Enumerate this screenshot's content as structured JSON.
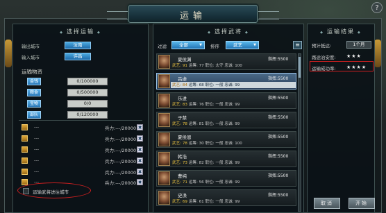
{
  "window": {
    "title": "运输",
    "help_label": "?"
  },
  "left_panel": {
    "title": "选择运输",
    "source_city_label": "输出城市",
    "source_city_value": "汝南",
    "target_city_label": "输入城市",
    "target_city_value": "许昌",
    "resources_heading": "运输物资",
    "resources": [
      {
        "label": "金钱",
        "value": "0/100000"
      },
      {
        "label": "粮食",
        "value": "0/500000"
      },
      {
        "label": "宝物",
        "value": "0/0"
      },
      {
        "label": "部队",
        "value": "0/120000"
      }
    ],
    "slots": [
      {
        "name": "---",
        "troops": "兵力:---/20000",
        "remove": "✖"
      },
      {
        "name": "---",
        "troops": "兵力:---/20000",
        "remove": "✖"
      },
      {
        "name": "---",
        "troops": "兵力:---/20000",
        "remove": "✖"
      },
      {
        "name": "---",
        "troops": "兵力:---/20000",
        "remove": "✖"
      },
      {
        "name": "---",
        "troops": "兵力:---/20000",
        "remove": "✖"
      },
      {
        "name": "---",
        "troops": "兵力:---/20000",
        "remove": "✖"
      }
    ],
    "move_checkbox_label": "运输武将进往城市"
  },
  "middle_panel": {
    "title": "选择武将",
    "filter_label": "过滤",
    "filter_value": "全部",
    "sort_label": "排序",
    "sort_value": "武艺",
    "list_icon": "≡",
    "generals": [
      {
        "name": "夏侯渊",
        "lead_label": "指挥:",
        "lead": "5500",
        "wu_label": "武艺:",
        "wu": "91",
        "zhi": "运筹: 77",
        "role": "职位: 太守",
        "loyal": "忠诚: 100",
        "selected": false
      },
      {
        "name": "吕虔",
        "lead_label": "指挥:",
        "lead": "5500",
        "wu_label": "武艺:",
        "wu": "84",
        "zhi": "运筹: 68",
        "role": "职位: 一般",
        "loyal": "忠诚: 99",
        "selected": true
      },
      {
        "name": "乐进",
        "lead_label": "指挥:",
        "lead": "5500",
        "wu_label": "武艺:",
        "wu": "83",
        "zhi": "运筹: 76",
        "role": "职位: 一般",
        "loyal": "忠诚: 99",
        "selected": false
      },
      {
        "name": "于禁",
        "lead_label": "指挥:",
        "lead": "5500",
        "wu_label": "武艺:",
        "wu": "78",
        "zhi": "运筹: 81",
        "role": "职位: 一般",
        "loyal": "忠诚: 99",
        "selected": false
      },
      {
        "name": "夏侯恩",
        "lead_label": "指挥:",
        "lead": "5500",
        "wu_label": "武艺:",
        "wu": "78",
        "zhi": "运筹: 30",
        "role": "职位: 一般",
        "loyal": "忠诚: 100",
        "selected": false
      },
      {
        "name": "韩浩",
        "lead_label": "指挥:",
        "lead": "5500",
        "wu_label": "武艺:",
        "wu": "73",
        "zhi": "运筹: 82",
        "role": "职位: 一般",
        "loyal": "忠诚: 99",
        "selected": false
      },
      {
        "name": "曹纯",
        "lead_label": "指挥:",
        "lead": "5500",
        "wu_label": "武艺:",
        "wu": "71",
        "zhi": "运筹: 56",
        "role": "职位: 一般",
        "loyal": "忠诚: 99",
        "selected": false
      },
      {
        "name": "史涣",
        "lead_label": "指挥:",
        "lead": "5500",
        "wu_label": "武艺:",
        "wu": "69",
        "zhi": "运筹: 61",
        "role": "职位: 一般",
        "loyal": "忠诚: 99",
        "selected": false
      }
    ]
  },
  "right_panel": {
    "title": "运输结果",
    "eta_label": "预计抵达:",
    "eta_value": "1个月",
    "safety_label": "路途治安度:",
    "safety_value": "★★★",
    "success_label": "运输成功率:",
    "success_value": "★★★★",
    "cancel_label": "取消",
    "confirm_label": "开始"
  }
}
